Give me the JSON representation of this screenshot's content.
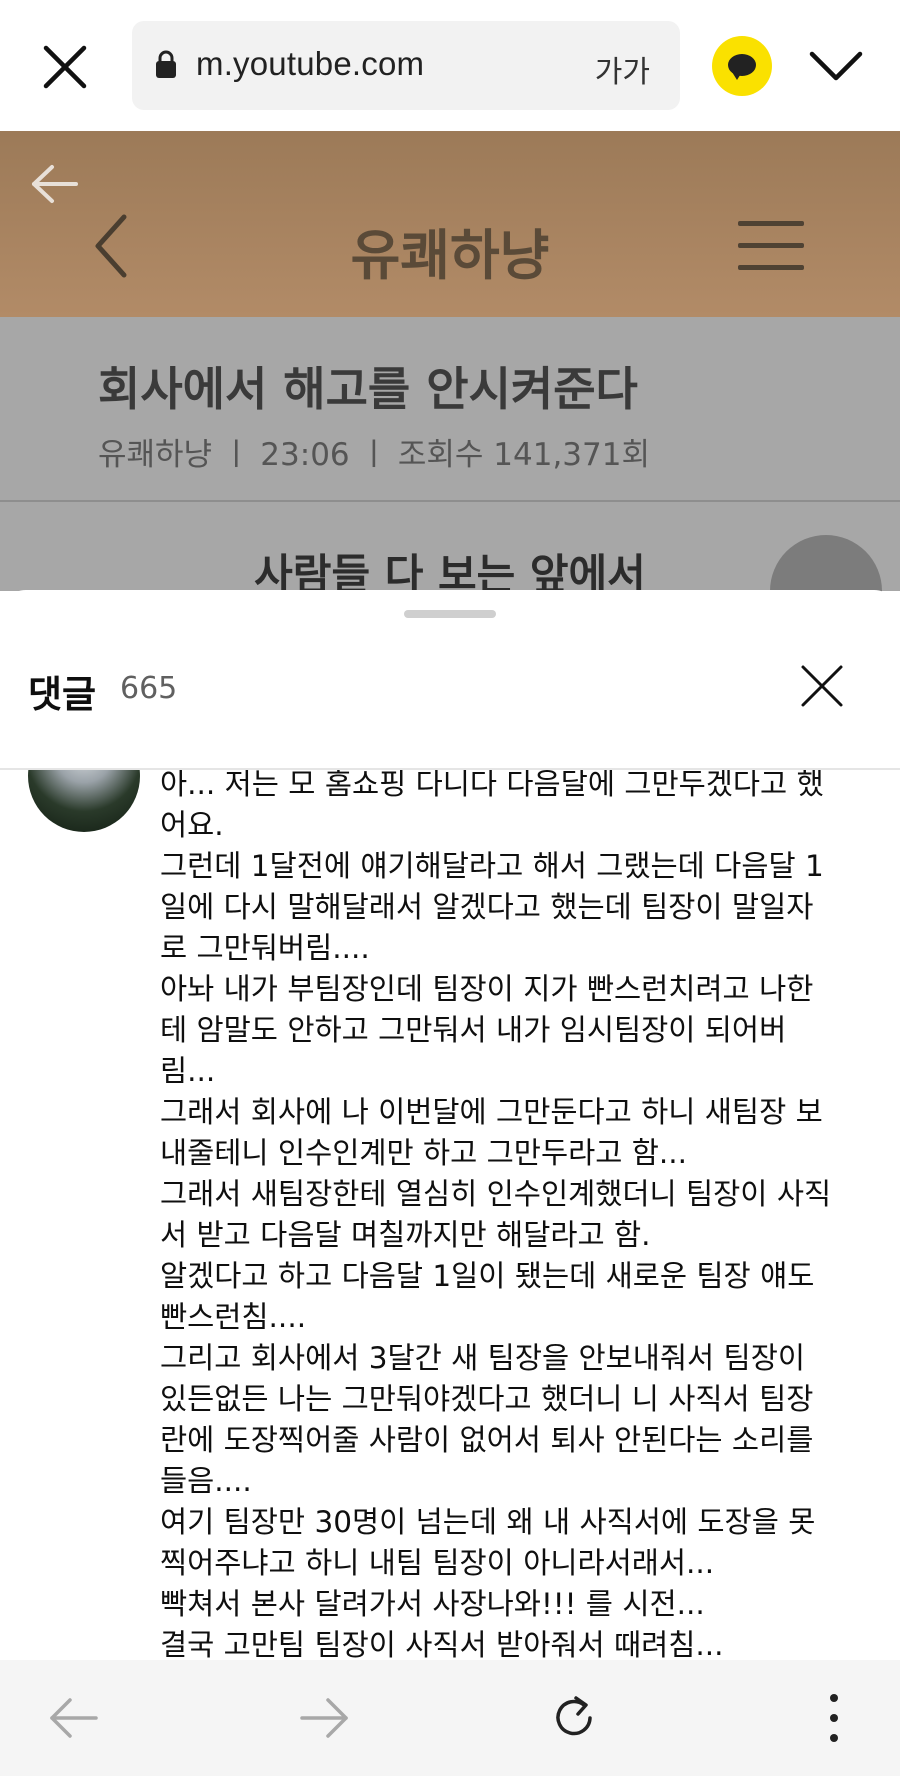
{
  "browser": {
    "url": "m.youtube.com",
    "text_size_label": "가가",
    "accent_color": "#fae100",
    "icons": [
      "close-icon",
      "lock-icon",
      "kakaotalk-icon",
      "chevron-down-icon",
      "back-arrow-icon",
      "forward-arrow-icon",
      "reload-icon",
      "more-icon"
    ]
  },
  "background_video": {
    "channel_header": "유쾌하냥",
    "headline": "회사에서 해고를 안시켜준다",
    "meta": "유쾌하냥 ㅣ 23:06 ㅣ 조회수 141,371회",
    "subtitle": "사람들 다 보는 앞에서"
  },
  "comments_sheet": {
    "title": "댓글",
    "count": "665",
    "comment_lines": [
      "아... 저는 모 홈쇼핑 다니다 다음달에 그만두겠다고 했",
      "어요.",
      "그런데 1달전에 얘기해달라고 해서 그랬는데 다음달 1",
      "일에 다시 말해달래서 알겠다고 했는데 팀장이 말일자",
      "로 그만둬버림....",
      "아놔 내가 부팀장인데 팀장이 지가 빤스런치려고 나한",
      "테 암말도 안하고 그만둬서 내가 임시팀장이 되어버",
      "림...",
      "그래서 회사에 나 이번달에 그만둔다고 하니 새팀장 보",
      "내줄테니 인수인계만 하고 그만두라고 함...",
      "그래서 새팀장한테 열심히 인수인계했더니 팀장이 사직",
      "서 받고 다음달 며칠까지만 해달라고 함.",
      "알겠다고 하고 다음달 1일이 됐는데 새로운 팀장 얘도",
      "빤스런침....",
      "그리고 회사에서 3달간 새 팀장을 안보내줘서 팀장이",
      "있든없든 나는 그만둬야겠다고 했더니 니 사직서 팀장",
      "란에 도장찍어줄 사람이 없어서 퇴사 안된다는 소리를",
      "들음....",
      "여기 팀장만 30명이 넘는데 왜 내 사직서에 도장을 못",
      "찍어주냐고 하니 내팀 팀장이 아니라서래서...",
      "빡쳐서 본사 달려가서 사장나와!!! 를 시전...",
      "결국 고만팀 팀장이 사직서 받아줘서 때려침..."
    ]
  }
}
